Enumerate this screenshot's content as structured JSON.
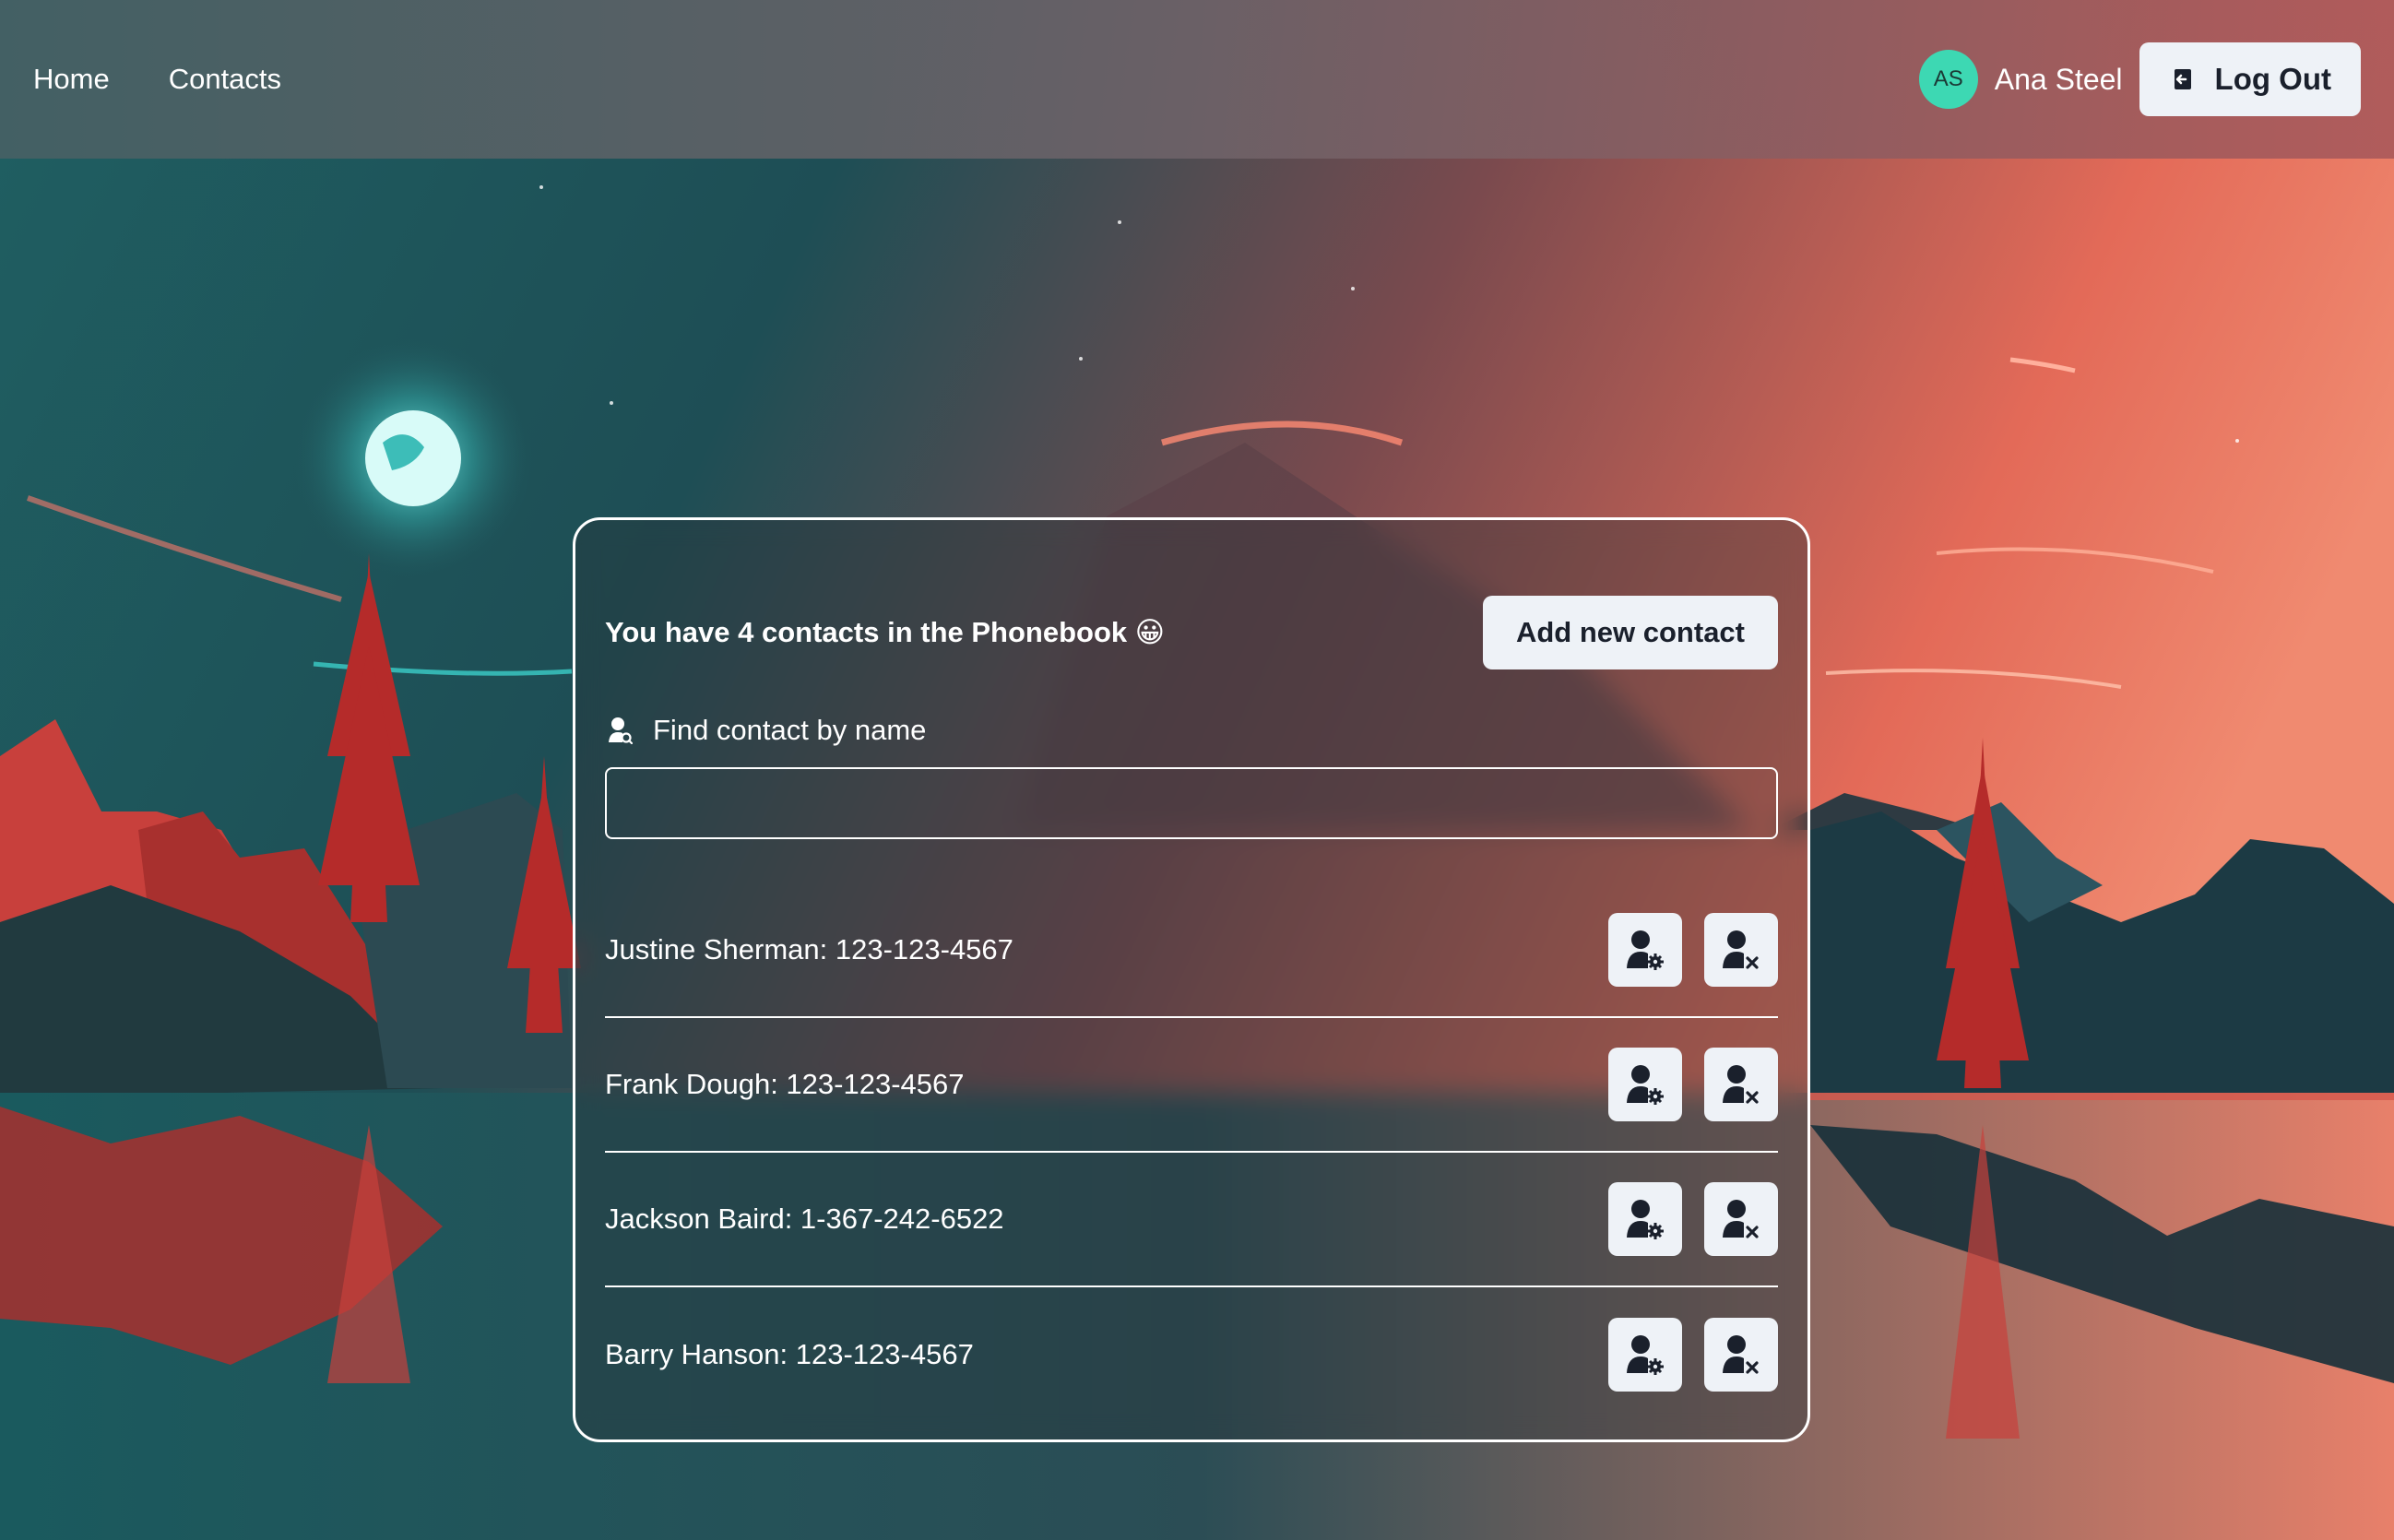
{
  "nav": {
    "links": [
      "Home",
      "Contacts"
    ]
  },
  "user": {
    "initials": "AS",
    "name": "Ana Steel",
    "logout_label": "Log Out"
  },
  "phonebook": {
    "title": "You have 4 contacts in the Phonebook 😀",
    "add_button_label": "Add new contact",
    "search_label": "Find contact by name",
    "search_value": "",
    "contacts": [
      {
        "text": "Justine Sherman: 123-123-4567"
      },
      {
        "text": "Frank Dough: 123-123-4567"
      },
      {
        "text": "Jackson Baird: 1-367-242-6522"
      },
      {
        "text": "Barry Hanson: 123-123-4567"
      }
    ]
  },
  "icons": {
    "edit": "user-gear-icon",
    "delete": "user-remove-icon",
    "search": "user-search-icon",
    "logout": "logout-icon"
  },
  "colors": {
    "avatar_bg": "#3dd8b3",
    "button_bg": "#eef2f7",
    "card_border": "#ffffff"
  }
}
